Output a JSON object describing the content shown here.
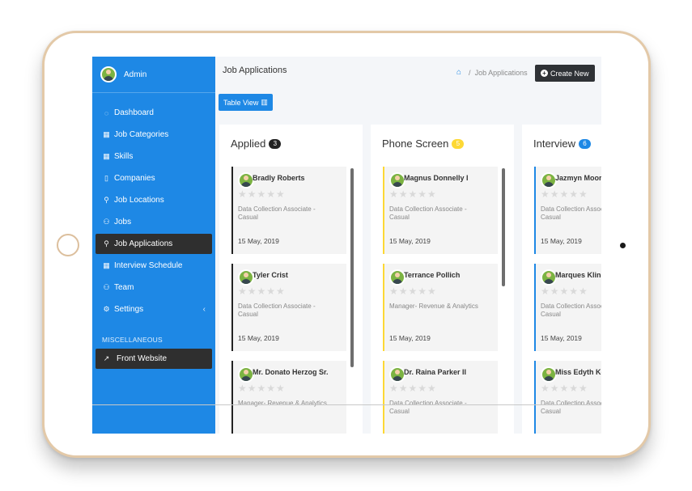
{
  "sidebar": {
    "user": "Admin",
    "items": [
      {
        "label": "Dashboard",
        "icon": "dashboard-icon",
        "glyph": "◌"
      },
      {
        "label": "Job Categories",
        "icon": "grid-icon",
        "glyph": "▦"
      },
      {
        "label": "Skills",
        "icon": "grid-icon",
        "glyph": "▦"
      },
      {
        "label": "Companies",
        "icon": "building-icon",
        "glyph": "▯"
      },
      {
        "label": "Job Locations",
        "icon": "location-pin-icon",
        "glyph": "⚲"
      },
      {
        "label": "Jobs",
        "icon": "users-icon",
        "glyph": "⚇"
      },
      {
        "label": "Job Applications",
        "icon": "user-icon",
        "glyph": "⚲"
      },
      {
        "label": "Interview Schedule",
        "icon": "calendar-icon",
        "glyph": "▦"
      },
      {
        "label": "Team",
        "icon": "team-icon",
        "glyph": "⚇"
      },
      {
        "label": "Settings",
        "icon": "gear-icon",
        "glyph": "⚙",
        "chevron": "‹"
      }
    ],
    "section": "MISCELLANEOUS",
    "front_website": {
      "label": "Front Website",
      "icon": "external-link-icon",
      "glyph": "↗"
    }
  },
  "header": {
    "title": "Job Applications",
    "breadcrumb": {
      "current": "Job Applications",
      "separator": "/"
    },
    "create_label": "Create New",
    "table_view_label": "Table View"
  },
  "columns": [
    {
      "title": "Applied",
      "count": "3",
      "accent": "#222222",
      "badge_text_color": "#ffffff",
      "cards": [
        {
          "name": "Bradly Roberts",
          "job": "Data Collection Associate - Casual",
          "date": "15 May, 2019"
        },
        {
          "name": "Tyler Crist",
          "job": "Data Collection Associate - Casual",
          "date": "15 May, 2019"
        },
        {
          "name": "Mr. Donato Herzog Sr.",
          "job": "Manager- Revenue & Analytics",
          "date": ""
        }
      ]
    },
    {
      "title": "Phone Screen",
      "count": "5",
      "accent": "#fdd835",
      "badge_text_color": "#ffffff",
      "cards": [
        {
          "name": "Magnus Donnelly I",
          "job": "Data Collection Associate - Casual",
          "date": "15 May, 2019"
        },
        {
          "name": "Terrance Pollich",
          "job": "Manager- Revenue & Analytics",
          "date": "15 May, 2019"
        },
        {
          "name": "Dr. Raina Parker II",
          "job": "Data Collection Associate - Casual",
          "date": ""
        }
      ]
    },
    {
      "title": "Interview",
      "count": "6",
      "accent": "#1e88e5",
      "badge_text_color": "#ffffff",
      "cards": [
        {
          "name": "Jazmyn Moore",
          "job": "Data Collection Associate - Casual",
          "date": "15 May, 2019"
        },
        {
          "name": "Marques Kling",
          "job": "Data Collection Associate - Casual",
          "date": "15 May, 2019"
        },
        {
          "name": "Miss Edyth Kozey",
          "job": "Data Collection Associate - Casual",
          "date": ""
        }
      ]
    }
  ],
  "rating_stars": "★★★★★",
  "colors": {
    "primary": "#1e88e5",
    "dark": "#2f3236",
    "frame": "#e3c9a8"
  }
}
